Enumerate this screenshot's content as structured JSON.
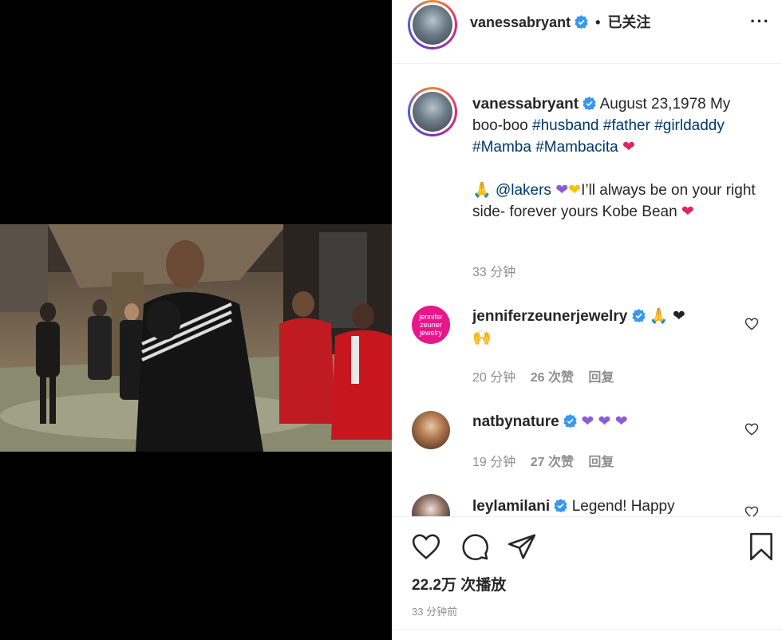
{
  "post": {
    "username": "vanessabryant",
    "separator": "•",
    "follow_status": "已关注",
    "more_label": "···"
  },
  "caption": {
    "username": "vanessabryant",
    "line1_text": "August 23,1978 My boo-boo",
    "hashtags": [
      "#husband",
      "#father",
      "#girldaddy",
      "#Mamba",
      "#Mambacita"
    ],
    "mention": "@lakers",
    "line2_text": "I’ll always be on your right side- forever yours Kobe Bean",
    "time": "33 分钟"
  },
  "comments": [
    {
      "username": "jenniferzeunerjewelry",
      "avatar_text": "jennifer zeuner jewelry",
      "time": "20 分钟",
      "likes": "26 次赞",
      "reply": "回复"
    },
    {
      "username": "natbynature",
      "time": "19 分钟",
      "likes": "27 次赞",
      "reply": "回复"
    },
    {
      "username": "leylamilani",
      "text": "Legend! Happy"
    }
  ],
  "stats": {
    "plays": "22.2万 次播放",
    "posted": "33 分钟前"
  },
  "icons": {
    "like": "heart-outline-icon",
    "comment": "comment-bubble-icon",
    "share": "paper-plane-icon",
    "save": "bookmark-icon",
    "verified": "verified-badge-icon"
  },
  "colors": {
    "hashtag": "#00376b",
    "verified": "#3897f0",
    "muted": "#8e8e8e",
    "text": "#262626"
  }
}
